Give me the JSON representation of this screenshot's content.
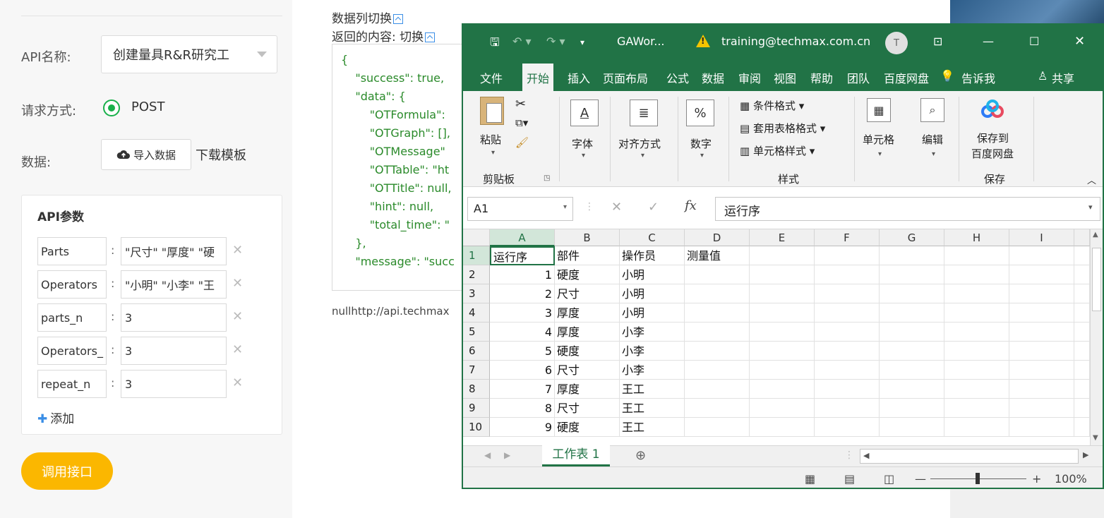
{
  "left": {
    "api_name_label": "API名称:",
    "api_name_value": "创建量具R&R研究工",
    "method_label": "请求方式:",
    "method_value": "POST",
    "data_label": "数据:",
    "import_label": "导入数据",
    "download_label": "下载模板",
    "params_title": "API参数",
    "params": [
      {
        "key": "Parts",
        "value": "\"尺寸\" \"厚度\" \"硬"
      },
      {
        "key": "Operators",
        "value": "\"小明\" \"小李\" \"王"
      },
      {
        "key": "parts_n",
        "value": "3"
      },
      {
        "key": "Operators_",
        "value": "3"
      },
      {
        "key": "repeat_n",
        "value": "3"
      }
    ],
    "add_label": "添加",
    "call_button": "调用接口"
  },
  "middle": {
    "title": "数据列切换",
    "subtitle": "返回的内容:  切换",
    "json_lines": [
      "{",
      "    \"success\": true,",
      "    \"data\": {",
      "        \"OTFormula\":",
      "        \"OTGraph\": [],",
      "        \"OTMessage\"",
      "        \"OTTable\": \"ht",
      "        \"OTTitle\": null,",
      "        \"hint\": null,",
      "        \"total_time\": \"",
      "    },",
      "    \"message\": \"succ"
    ],
    "url_text": "nullhttp://api.techmax"
  },
  "excel": {
    "doc_title": "GAWor...",
    "account": "training@techmax.com.cn",
    "avatar_letter": "T",
    "tabs": [
      "文件",
      "开始",
      "插入",
      "页面布局",
      "公式",
      "数据",
      "审阅",
      "视图",
      "帮助",
      "团队",
      "百度网盘",
      "告诉我"
    ],
    "share": "共享",
    "ribbon": {
      "paste": "粘贴",
      "clipboard": "剪贴板",
      "font": "字体",
      "align": "对齐方式",
      "number": "数字",
      "cond_format": "条件格式",
      "table_format": "套用表格格式",
      "cell_style": "单元格样式",
      "styles": "样式",
      "cells": "单元格",
      "edit": "编辑",
      "save_to_1": "保存到",
      "save_to_2": "百度网盘",
      "save": "保存"
    },
    "name_box": "A1",
    "fx": "fx",
    "formula_value": "运行序",
    "columns": [
      "A",
      "B",
      "C",
      "D",
      "E",
      "F",
      "G",
      "H",
      "I"
    ],
    "rows": [
      {
        "n": "1",
        "a": "运行序",
        "b": "部件",
        "c": "操作员",
        "d": "测量值"
      },
      {
        "n": "2",
        "a": "1",
        "b": "硬度",
        "c": "小明",
        "d": ""
      },
      {
        "n": "3",
        "a": "2",
        "b": "尺寸",
        "c": "小明",
        "d": ""
      },
      {
        "n": "4",
        "a": "3",
        "b": "厚度",
        "c": "小明",
        "d": ""
      },
      {
        "n": "5",
        "a": "4",
        "b": "厚度",
        "c": "小李",
        "d": ""
      },
      {
        "n": "6",
        "a": "5",
        "b": "硬度",
        "c": "小李",
        "d": ""
      },
      {
        "n": "7",
        "a": "6",
        "b": "尺寸",
        "c": "小李",
        "d": ""
      },
      {
        "n": "8",
        "a": "7",
        "b": "厚度",
        "c": "王工",
        "d": ""
      },
      {
        "n": "9",
        "a": "8",
        "b": "尺寸",
        "c": "王工",
        "d": ""
      },
      {
        "n": "10",
        "a": "9",
        "b": "硬度",
        "c": "王工",
        "d": ""
      }
    ],
    "sheet_tab": "工作表 1",
    "zoom": "100%",
    "colors": {
      "accent": "#217346",
      "button": "#fbb700",
      "radio": "#18b04a"
    }
  }
}
